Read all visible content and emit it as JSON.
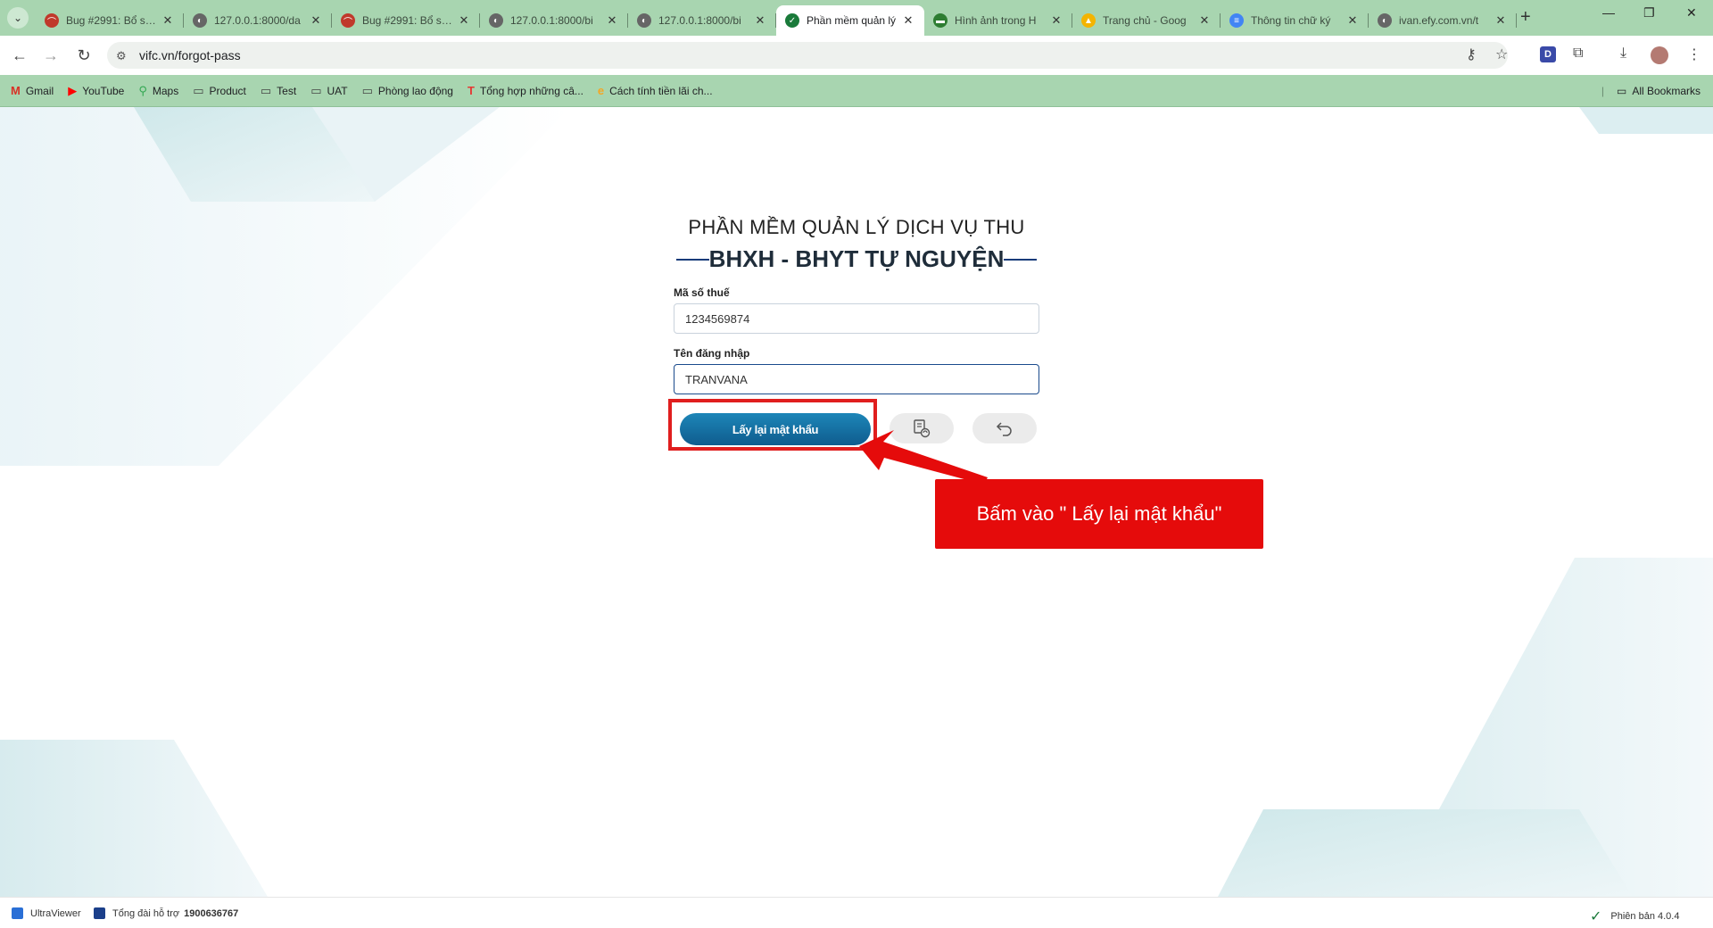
{
  "browser": {
    "tabs": [
      {
        "title": "Bug #2991: Bổ sung",
        "fav_color": "#c0392b",
        "fav_glyph": "⌒"
      },
      {
        "title": "127.0.0.1:8000/da",
        "fav_color": "#666666",
        "fav_glyph": "◐"
      },
      {
        "title": "Bug #2991: Bổ sung",
        "fav_color": "#c0392b",
        "fav_glyph": "⌒"
      },
      {
        "title": "127.0.0.1:8000/bi",
        "fav_color": "#666666",
        "fav_glyph": "◐"
      },
      {
        "title": "127.0.0.1:8000/bi",
        "fav_color": "#666666",
        "fav_glyph": "◐"
      },
      {
        "title": "Phần mềm quản lý",
        "fav_color": "#1a7a3a",
        "fav_glyph": "✓",
        "active": true
      },
      {
        "title": "Hình ảnh trong H",
        "fav_color": "#2e7d32",
        "fav_glyph": "▬"
      },
      {
        "title": "Trang chủ - Goog",
        "fav_color": "#f4b400",
        "fav_glyph": "▲"
      },
      {
        "title": "Thông tin chữ ký",
        "fav_color": "#4285f4",
        "fav_glyph": "≡"
      },
      {
        "title": "ivan.efy.com.vn/t",
        "fav_color": "#666666",
        "fav_glyph": "◐"
      }
    ],
    "url": "vifc.vn/forgot-pass",
    "bookmarks": [
      {
        "label": "Gmail",
        "icon": "gmail-icon",
        "glyph": "M",
        "color": "#d93025"
      },
      {
        "label": "YouTube",
        "icon": "youtube-icon",
        "glyph": "▶",
        "color": "#ff0000"
      },
      {
        "label": "Maps",
        "icon": "maps-icon",
        "glyph": "⚲",
        "color": "#34a853"
      },
      {
        "label": "Product",
        "icon": "folder-icon",
        "glyph": "▭",
        "color": "#444444"
      },
      {
        "label": "Test",
        "icon": "folder-icon",
        "glyph": "▭",
        "color": "#444444"
      },
      {
        "label": "UAT",
        "icon": "folder-icon",
        "glyph": "▭",
        "color": "#444444"
      },
      {
        "label": "Phòng lao động",
        "icon": "folder-icon",
        "glyph": "▭",
        "color": "#444444"
      },
      {
        "label": "Tổng hợp những câ...",
        "icon": "site-icon",
        "glyph": "T",
        "color": "#e53935"
      },
      {
        "label": "Cách tính tiền lãi ch...",
        "icon": "site-icon",
        "glyph": "e",
        "color": "#f5a623"
      }
    ],
    "all_bookmarks": "All Bookmarks"
  },
  "form": {
    "title_line1": "PHẦN MỀM QUẢN LÝ DỊCH VỤ THU",
    "title_line2": "BHXH - BHYT TỰ NGUYỆN",
    "tax_label": "Mã số thuế",
    "tax_value": "1234569874",
    "username_label": "Tên đăng nhập",
    "username_value": "TRANVANA",
    "submit_label": "Lấy lại mật khẩu"
  },
  "annotation": {
    "callout_text": "Bấm vào \" Lấy lại mật khẩu\"",
    "color": "#e50b0b"
  },
  "statusbar": {
    "ultraviewer": "UltraViewer",
    "hotline_label": "Tổng đài hỗ trợ",
    "hotline_number": "1900636767",
    "version": "Phiên bản 4.0.4"
  }
}
